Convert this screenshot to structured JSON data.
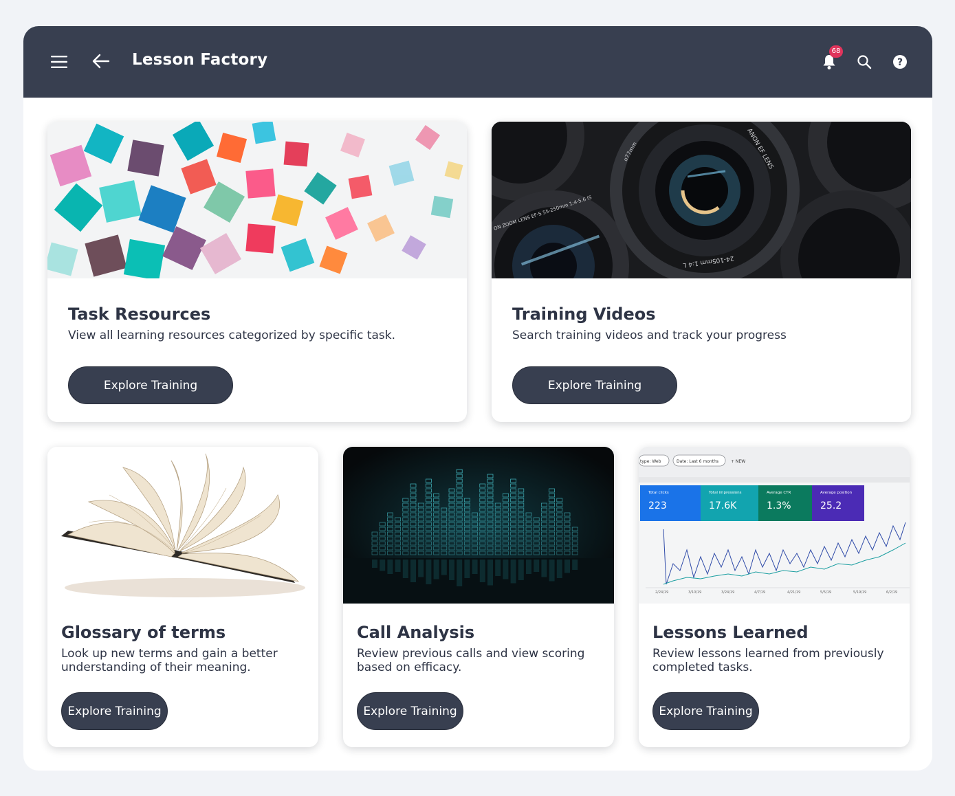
{
  "header": {
    "title": "Lesson Factory",
    "notification_count": "68"
  },
  "cards": [
    {
      "title": "Task Resources",
      "description": "View all learning resources categorized by specific task.",
      "button": "Explore Training"
    },
    {
      "title": "Training Videos",
      "description": "Search training videos and track your progress",
      "button": "Explore Training",
      "image_text": {
        "lens_top": "ANON EF LENS",
        "lens_left": "ON ZOOM LENS EF-S 55-250mm 1:4-5.6 IS",
        "lens_bottom": "24-105mm 1:4 L",
        "lens_side": "⌀77mm"
      }
    },
    {
      "title": "Glossary of terms",
      "description": "Look up new terms and gain a better understanding of their meaning.",
      "button": "Explore Training"
    },
    {
      "title": "Call Analysis",
      "description": "Review previous calls and view scoring based on efficacy.",
      "button": "Explore Training"
    },
    {
      "title": "Lessons Learned",
      "description": "Review lessons learned from previously completed tasks.",
      "button": "Explore Training",
      "image_text": {
        "filters": [
          "type: Web",
          "Date: Last 6 months",
          "+ NEW"
        ],
        "metrics": [
          {
            "label": "Total clicks",
            "value": "223",
            "color": "#1a73e8"
          },
          {
            "label": "Total impressions",
            "value": "17.6K",
            "color": "#12a4af"
          },
          {
            "label": "Average CTR",
            "value": "1.3%",
            "color": "#0b7a5e"
          },
          {
            "label": "Average position",
            "value": "25.2",
            "color": "#4b2bb5"
          }
        ],
        "dates": [
          "2/24/19",
          "3/10/19",
          "3/24/19",
          "4/7/19",
          "4/21/19",
          "5/5/19",
          "5/19/19",
          "6/2/19"
        ]
      }
    }
  ]
}
